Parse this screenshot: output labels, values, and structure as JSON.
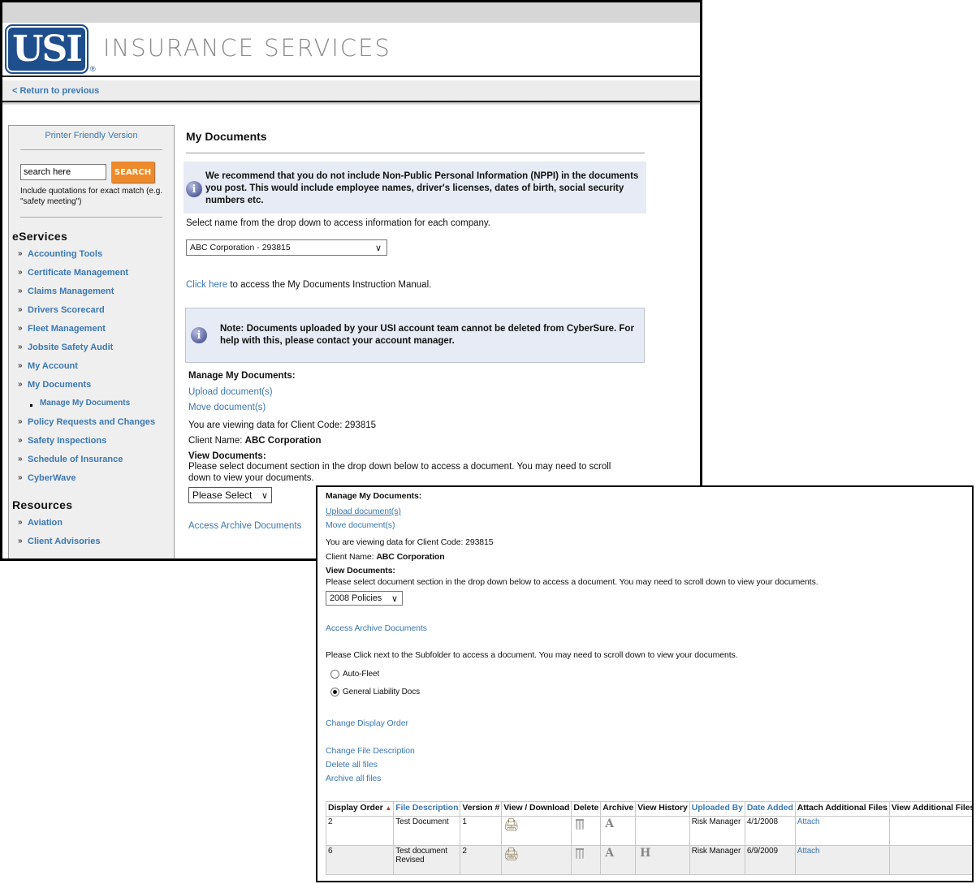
{
  "header": {
    "logo_text": "USI",
    "registered_mark": "®",
    "brand_name": "INSURANCE SERVICES",
    "return_link": "< Return to previous"
  },
  "sidebar": {
    "printer_friendly": "Printer Friendly Version",
    "search": {
      "placeholder": "search here",
      "value": "search here",
      "button_label": "SEARCH",
      "hint": "Include quotations for exact match (e.g. \"safety meeting\")"
    },
    "eservices_heading": "eServices",
    "eservices_items": [
      {
        "label": "Accounting Tools"
      },
      {
        "label": "Certificate Management"
      },
      {
        "label": "Claims Management"
      },
      {
        "label": "Drivers Scorecard"
      },
      {
        "label": "Fleet Management"
      },
      {
        "label": "Jobsite Safety Audit"
      },
      {
        "label": "My Account"
      },
      {
        "label": "My Documents"
      }
    ],
    "sub_item": "Manage My Documents",
    "eservices_items_after": [
      {
        "label": "Policy Requests and Changes"
      },
      {
        "label": "Safety Inspections"
      },
      {
        "label": "Schedule of Insurance"
      },
      {
        "label": "CyberWave"
      }
    ],
    "resources_heading": "Resources",
    "resources_items": [
      {
        "label": "Aviation"
      },
      {
        "label": "Client Advisories"
      }
    ]
  },
  "main": {
    "title": "My Documents",
    "nppi_notice": "We recommend that you do not include Non-Public Personal Information (NPPI) in the documents you post. This would include employee names, driver's licenses, dates of birth, social security numbers etc.",
    "select_instruction": "Select name from the drop down to access information for each company.",
    "company_select": "ABC Corporation - 293815",
    "manual_link": "Click here",
    "manual_text": " to access the My Documents Instruction Manual.",
    "note": "Note: Documents uploaded by your USI account team cannot be deleted from CyberSure. For help with this, please contact your account manager.",
    "manage_heading": "Manage My Documents:",
    "upload_link": "Upload document(s)",
    "move_link": "Move document(s)",
    "client_code_text": "You are viewing data for Client Code: 293815",
    "client_name_label": "Client Name: ",
    "client_name": "ABC Corporation",
    "view_heading": "View Documents:",
    "view_instruction": "Please select document section in the drop down below to access a document. You may need to scroll down to view your documents.",
    "section_select": "Please Select",
    "archive_link": "Access Archive Documents"
  },
  "overlay": {
    "manage_heading": "Manage My Documents:",
    "upload_link": "Upload document(s)",
    "move_link": "Move document(s)",
    "client_code_text": "You are viewing data for Client Code: 293815",
    "client_name_label": "Client Name: ",
    "client_name": "ABC Corporation",
    "view_heading": "View Documents:",
    "view_instruction": "Please select document section in the drop down below to access a document. You may need to scroll down to view your documents.",
    "section_select": "2008 Policies",
    "archive_link": "Access Archive Documents",
    "subfolder_instruction": "Please Click next to the Subfolder to access a document. You may need to scroll down to view your documents.",
    "subfolders": [
      {
        "label": "Auto-Fleet",
        "checked": false
      },
      {
        "label": "General Liability Docs",
        "checked": true
      }
    ],
    "change_display_order": "Change Display Order",
    "change_file_description": "Change File Description",
    "delete_all": "Delete all files",
    "archive_all": "Archive all files",
    "table": {
      "columns": [
        "Display Order",
        "File Description",
        "Version #",
        "View / Download",
        "Delete",
        "Archive",
        "View History",
        "Uploaded By",
        "Date Added",
        "Attach Additional Files",
        "View Additional Files"
      ],
      "sort_indicator": "▲",
      "rows": [
        {
          "display_order": "2",
          "file_description": "Test Document",
          "version": "1",
          "view_icon": "download-icon",
          "delete_icon": "trash-icon",
          "archive_icon": "A",
          "history_icon": "",
          "uploaded_by": "Risk Manager",
          "date_added": "4/1/2008",
          "attach": "Attach",
          "view_additional": ""
        },
        {
          "display_order": "6",
          "file_description": "Test document Revised",
          "version": "2",
          "view_icon": "download-icon",
          "delete_icon": "trash-icon",
          "archive_icon": "A",
          "history_icon": "H",
          "uploaded_by": "Risk Manager",
          "date_added": "6/9/2009",
          "attach": "Attach",
          "view_additional": ""
        }
      ]
    }
  },
  "colors": {
    "link": "#3b78b4",
    "brand_blue": "#1f4e8c",
    "search_button": "#ee8a2a",
    "info_box_bg": "#e6ebf5",
    "sidebar_bg": "#efefef"
  }
}
